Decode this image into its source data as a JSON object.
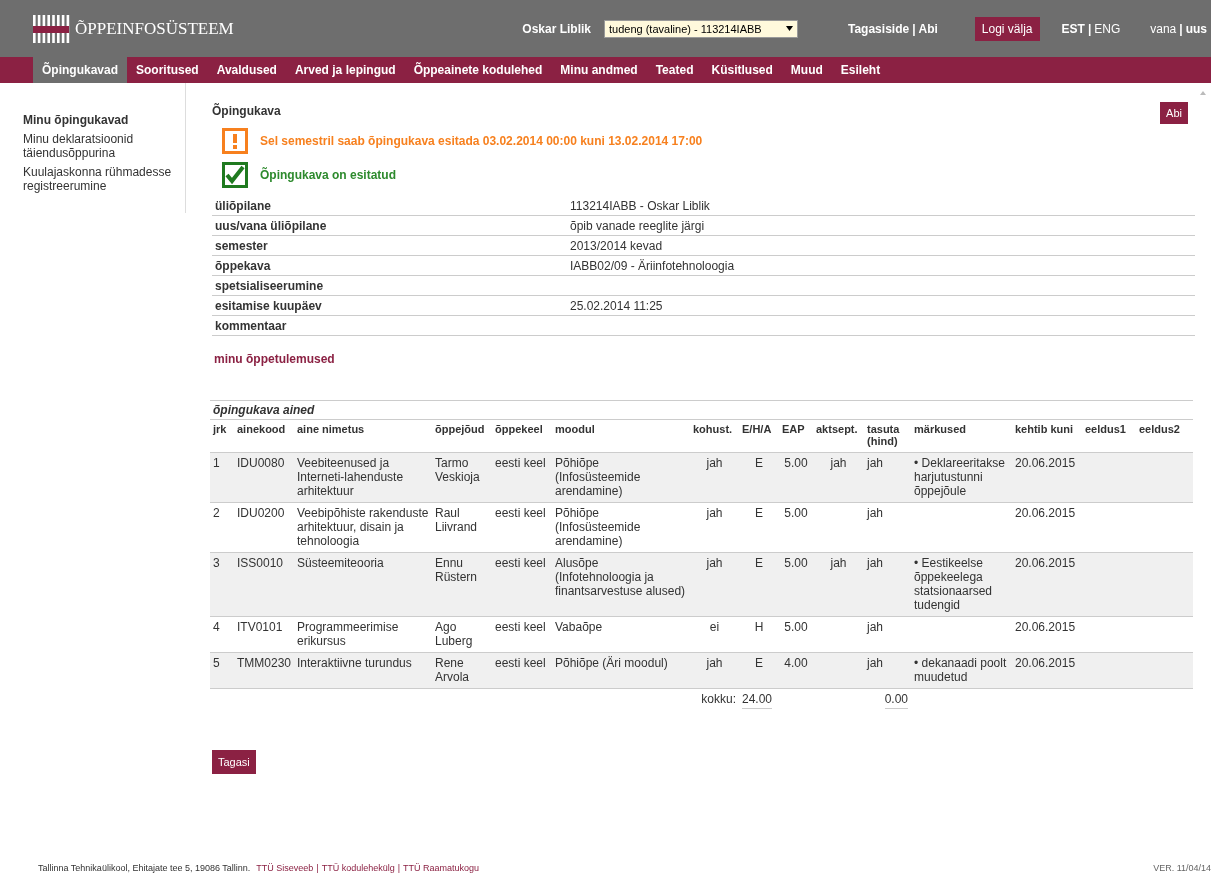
{
  "header": {
    "logo_text": "ÕPPEINFOSÜSTEEM",
    "user_name": "Oskar Liblik",
    "role_select": "tudeng (tavaline) - 113214IABB",
    "links": [
      "Tagasiside",
      "Abi"
    ],
    "link_separator": "|",
    "language_separator": "|",
    "version_separator": "|",
    "logout": "Logi välja",
    "languages": [
      {
        "label": "EST",
        "selected": true
      },
      {
        "label": "ENG",
        "selected": false
      }
    ],
    "versions": [
      {
        "label": "vana",
        "selected": false
      },
      {
        "label": "uus",
        "selected": true
      }
    ]
  },
  "nav": [
    {
      "label": "Õpingukavad",
      "selected": true
    },
    {
      "label": "Sooritused",
      "selected": false
    },
    {
      "label": "Avaldused",
      "selected": false
    },
    {
      "label": "Arved ja lepingud",
      "selected": false
    },
    {
      "label": "Õppeainete kodulehed",
      "selected": false
    },
    {
      "label": "Minu andmed",
      "selected": false
    },
    {
      "label": "Teated",
      "selected": false
    },
    {
      "label": "Küsitlused",
      "selected": false
    },
    {
      "label": "Muud",
      "selected": false
    },
    {
      "label": "Esileht",
      "selected": false
    }
  ],
  "sidebar": [
    {
      "label": "Minu õpingukavad",
      "selected": true
    },
    {
      "label": "Minu deklaratsioonid täiendusõppurina",
      "selected": false
    },
    {
      "label": "Kuulajaskonna rühmadesse registreerumine",
      "selected": false
    }
  ],
  "page_title": "Õpingukava",
  "help_button": "Abi",
  "notices": [
    {
      "kind": "warning",
      "text": "Sel semestril saab õpingukava esitada 03.02.2014 00:00 kuni 13.02.2014 17:00"
    },
    {
      "kind": "success",
      "text": "Õpingukava on esitatud"
    }
  ],
  "info": [
    {
      "label": "üliõpilane",
      "value": "113214IABB - Oskar Liblik"
    },
    {
      "label": "uus/vana üliõpilane",
      "value": "õpib vanade reeglite järgi"
    },
    {
      "label": "semester",
      "value": "2013/2014 kevad"
    },
    {
      "label": "õppekava",
      "value": "IABB02/09 - Äriinfotehnoloogia"
    },
    {
      "label": "spetsialiseerumine"
    },
    {
      "label": "esitamise kuupäev",
      "value": "25.02.2014 11:25"
    },
    {
      "label": "kommentaar"
    }
  ],
  "results_link": "minu õppetulemused",
  "table": {
    "caption": "õpingukava ained",
    "columns": [
      "jrk",
      "ainekood",
      "aine nimetus",
      "õppejõud",
      "õppekeel",
      "moodul",
      "kohust.",
      "E/H/A",
      "EAP",
      "aktsept.",
      "tasuta (hind)",
      "märkused",
      "kehtib kuni",
      "eeldus1",
      "eeldus2"
    ],
    "rows": [
      {
        "cells": [
          "1",
          "IDU0080",
          "Veebiteenused ja Interneti-lahenduste arhitektuur",
          "Tarmo Veskioja",
          "eesti keel",
          "Põhiõpe (Infosüsteemide arendamine)",
          "jah",
          "E",
          "5.00",
          "jah",
          "jah",
          "• Deklareeritakse harjutustunni õppejõule",
          "20.06.2015",
          "",
          ""
        ]
      },
      {
        "cells": [
          "2",
          "IDU0200",
          "Veebipõhiste rakenduste arhitektuur, disain ja tehnoloogia",
          "Raul Liivrand",
          "eesti keel",
          "Põhiõpe (Infosüsteemide arendamine)",
          "jah",
          "E",
          "5.00",
          "",
          "jah",
          "",
          "20.06.2015",
          "",
          ""
        ]
      },
      {
        "cells": [
          "3",
          "ISS0010",
          "Süsteemiteooria",
          "Ennu Rüstern",
          "eesti keel",
          "Alusõpe (Infotehnoloogia ja finantsarvestuse alused)",
          "jah",
          "E",
          "5.00",
          "jah",
          "jah",
          "• Eestikeelse õppekeelega statsionaarsed tudengid",
          "20.06.2015",
          "",
          ""
        ]
      },
      {
        "cells": [
          "4",
          "ITV0101",
          "Programmeerimise erikursus",
          "Ago Luberg",
          "eesti keel",
          "Vabaõpe",
          "ei",
          "H",
          "5.00",
          "",
          "jah",
          "",
          "20.06.2015",
          "",
          ""
        ]
      },
      {
        "cells": [
          "5",
          "TMM0230",
          "Interaktiivne turundus",
          "Rene Arvola",
          "eesti keel",
          "Põhiõpe (Äri moodul)",
          "jah",
          "E",
          "4.00",
          "",
          "jah",
          "• dekanaadi poolt muudetud",
          "20.06.2015",
          "",
          ""
        ]
      }
    ],
    "total_label": "kokku:",
    "total_eap": "24.00",
    "total_price": "0.00"
  },
  "back_button": "Tagasi",
  "footer": {
    "address": "Tallinna Tehnikaülikool, Ehitajate tee 5, 19086 Tallinn.",
    "links": [
      "TTÜ Siseveeb",
      "TTÜ kodulehekülg",
      "TTÜ Raamatukogu"
    ],
    "link_separators": [
      "|",
      "|"
    ],
    "version": "VER. 11/04/14"
  }
}
